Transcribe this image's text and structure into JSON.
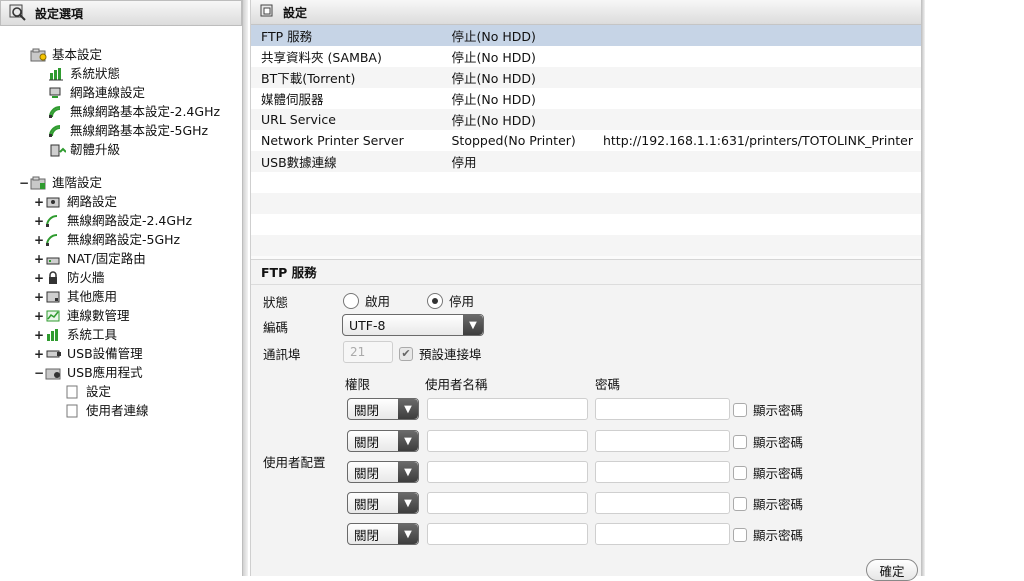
{
  "left": {
    "title": "設定選項",
    "basic": {
      "label": "基本設定",
      "items": [
        "系統狀態",
        "網路連線設定",
        "無線網路基本設定-2.4GHz",
        "無線網路基本設定-5GHz",
        "韌體升級"
      ]
    },
    "advanced": {
      "label": "進階設定",
      "toggle": "−",
      "items": [
        {
          "label": "網路設定",
          "toggle": "+"
        },
        {
          "label": "無線網路設定-2.4GHz",
          "toggle": "+"
        },
        {
          "label": "無線網路設定-5GHz",
          "toggle": "+"
        },
        {
          "label": "NAT/固定路由",
          "toggle": "+"
        },
        {
          "label": "防火牆",
          "toggle": "+"
        },
        {
          "label": "其他應用",
          "toggle": "+"
        },
        {
          "label": "連線數管理",
          "toggle": "+"
        },
        {
          "label": "系統工具",
          "toggle": "+"
        },
        {
          "label": "USB設備管理",
          "toggle": "+"
        },
        {
          "label": "USB應用程式",
          "toggle": "−"
        }
      ],
      "usb_app_children": [
        "設定",
        "使用者連線"
      ]
    }
  },
  "right": {
    "title": "設定",
    "services": [
      [
        "FTP 服務",
        "停止(No HDD)",
        ""
      ],
      [
        "共享資料夾 (SAMBA)",
        "停止(No HDD)",
        ""
      ],
      [
        "BT下載(Torrent)",
        "停止(No HDD)",
        ""
      ],
      [
        "媒體伺服器",
        "停止(No HDD)",
        ""
      ],
      [
        "URL Service",
        "停止(No HDD)",
        ""
      ],
      [
        "Network Printer Server",
        "Stopped(No Printer)",
        "http://192.168.1.1:631/printers/TOTOLINK_Printer"
      ],
      [
        "USB數據連線",
        "停用",
        ""
      ]
    ],
    "ftp": {
      "section_title": "FTP 服務",
      "status_label": "狀態",
      "enable_label": "啟用",
      "disable_label": "停用",
      "encoding_label": "編碼",
      "encoding_value": "UTF-8",
      "port_label": "通訊埠",
      "port_value": "21",
      "default_port_label": "預設連接埠",
      "user_config_label": "使用者配置",
      "col_permission": "權限",
      "col_username": "使用者名稱",
      "col_password": "密碼",
      "users": [
        {
          "permission": "關閉",
          "show_password": "顯示密碼"
        },
        {
          "permission": "關閉",
          "show_password": "顯示密碼"
        },
        {
          "permission": "關閉",
          "show_password": "顯示密碼"
        },
        {
          "permission": "關閉",
          "show_password": "顯示密碼"
        },
        {
          "permission": "關閉",
          "show_password": "顯示密碼"
        }
      ],
      "confirm": "確定"
    }
  }
}
